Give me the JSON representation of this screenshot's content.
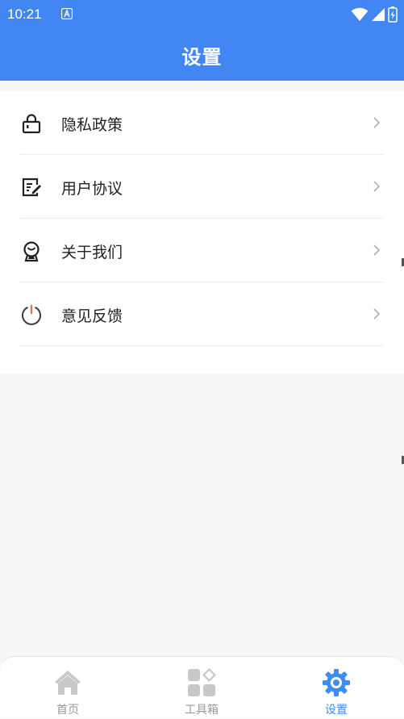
{
  "status_bar": {
    "time": "10:21"
  },
  "app_bar": {
    "title": "设置"
  },
  "menu": {
    "items": [
      {
        "label": "隐私政策",
        "icon": "lock-icon"
      },
      {
        "label": "用户协议",
        "icon": "edit-document-icon"
      },
      {
        "label": "关于我们",
        "icon": "badge-icon"
      },
      {
        "label": "意见反馈",
        "icon": "power-icon"
      }
    ]
  },
  "tab_bar": {
    "tabs": [
      {
        "label": "首页",
        "icon": "home-icon"
      },
      {
        "label": "工具箱",
        "icon": "toolbox-icon"
      },
      {
        "label": "设置",
        "icon": "gear-icon",
        "active": true
      }
    ]
  },
  "colors": {
    "primary": "#4286f4",
    "tab_active": "#3d8ef0",
    "tab_inactive": "#c8c8c8",
    "background": "#f7f7f7",
    "power_accent": "#e8743b"
  }
}
